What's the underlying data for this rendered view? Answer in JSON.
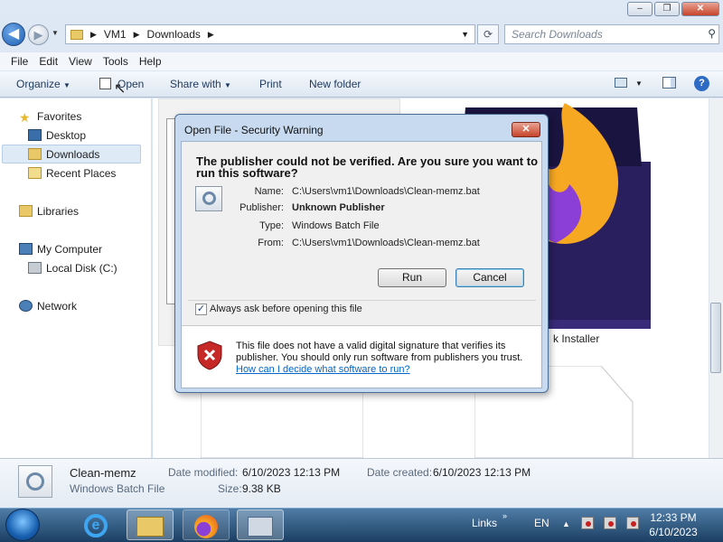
{
  "window": {
    "controls": {
      "minimize": "–",
      "maximize": "❐",
      "close": "✕"
    }
  },
  "address": {
    "segments": [
      "VM1",
      "Downloads"
    ],
    "separator": "▶",
    "search_placeholder": "Search Downloads"
  },
  "menu": [
    "File",
    "Edit",
    "View",
    "Tools",
    "Help"
  ],
  "toolbar": {
    "organize": "Organize",
    "open": "Open",
    "share_with": "Share with",
    "print": "Print",
    "new_folder": "New folder"
  },
  "nav": {
    "favorites": "Favorites",
    "desktop": "Desktop",
    "downloads": "Downloads",
    "recent_places": "Recent Places",
    "libraries": "Libraries",
    "my_computer": "My Computer",
    "local_disk": "Local Disk (C:)",
    "network": "Network"
  },
  "content": {
    "installer_label": "k Installer"
  },
  "dialog": {
    "title": "Open File - Security Warning",
    "close": "✕",
    "question_line1": "The publisher could not be verified.  Are you sure you want to",
    "question_line2": "run this software?",
    "fields": [
      {
        "label": "Name:",
        "value": "C:\\Users\\vm1\\Downloads\\Clean-memz.bat",
        "bold": false
      },
      {
        "label": "Publisher:",
        "value": "Unknown Publisher",
        "bold": true
      },
      {
        "label": "Type:",
        "value": "Windows Batch File",
        "bold": false
      },
      {
        "label": "From:",
        "value": "C:\\Users\\vm1\\Downloads\\Clean-memz.bat",
        "bold": false
      }
    ],
    "run": "Run",
    "cancel": "Cancel",
    "always_ask": "Always ask before opening this file",
    "always_ask_checked": true,
    "warning_line1": "This file does not have a valid digital signature that verifies its",
    "warning_line2": "publisher.  You should only run software from publishers you trust.",
    "help_link": "How can I decide what software to run?"
  },
  "details": {
    "filename": "Clean-memz",
    "filetype": "Windows Batch File",
    "date_modified_label": "Date modified:",
    "date_modified": "6/10/2023 12:13 PM",
    "date_created_label": "Date created:",
    "date_created": "6/10/2023 12:13 PM",
    "size_label": "Size:",
    "size": "9.38 KB"
  },
  "taskbar": {
    "links": "Links",
    "language": "EN",
    "time": "12:33 PM",
    "date": "6/10/2023"
  },
  "colors": {
    "accent": "#2e6bc4",
    "link": "#0066cc",
    "warning_red": "#c6442a",
    "taskbar": "#1c3f63"
  }
}
